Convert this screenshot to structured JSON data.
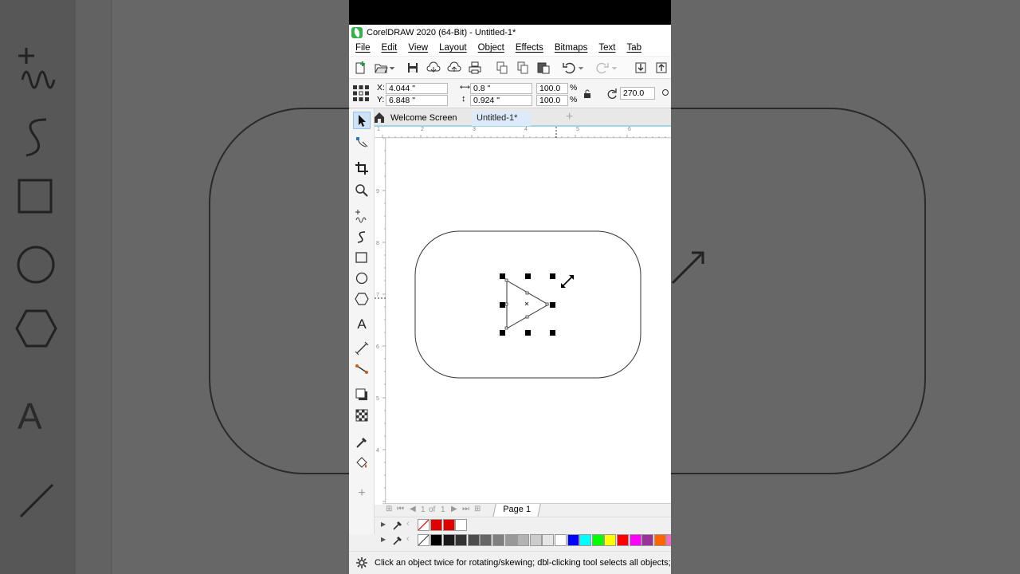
{
  "window": {
    "title": "CorelDRAW 2020 (64-Bit) - Untitled-1*"
  },
  "menu": [
    "File",
    "Edit",
    "View",
    "Layout",
    "Object",
    "Effects",
    "Bitmaps",
    "Text",
    "Tab"
  ],
  "toolbar": {
    "icons": [
      "new-document-icon",
      "open-icon",
      "dropdown-icon",
      "save-icon",
      "cloud-download-icon",
      "cloud-upload-icon",
      "print-icon",
      "cut-icon",
      "copy-icon",
      "paste-icon",
      "undo-icon",
      "redo-icon",
      "import-icon",
      "export-icon"
    ]
  },
  "properties": {
    "x_label": "X:",
    "x_value": "4.044 \"",
    "y_label": "Y:",
    "y_value": "6.848 \"",
    "width_value": "0.8 \"",
    "height_value": "0.924 \"",
    "scale_x": "100.0",
    "scale_y": "100.0",
    "percent": "%",
    "rotation": "270.0"
  },
  "tabs": [
    {
      "label": "Welcome Screen",
      "active": false
    },
    {
      "label": "Untitled-1*",
      "active": true
    }
  ],
  "ruler": {
    "h_ticks": [
      "1",
      "2",
      "3",
      "4",
      "5",
      "6"
    ],
    "v_ticks": [
      "9",
      "8",
      "7",
      "6",
      "5",
      "4"
    ]
  },
  "page_nav": {
    "current": "1",
    "of_label": "of",
    "total": "1",
    "page_tab": "Page 1"
  },
  "palette": {
    "document_colors": [
      "#e00000",
      "#e00000",
      "#ffffff"
    ],
    "default_colors": [
      "#000000",
      "#1a1a1a",
      "#333333",
      "#4d4d4d",
      "#666666",
      "#808080",
      "#999999",
      "#b3b3b3",
      "#cccccc",
      "#e6e6e6",
      "#ffffff",
      "#0000ff",
      "#00ffff",
      "#00ff00",
      "#ffff00",
      "#ff0000",
      "#ff00ff",
      "#993399",
      "#ff6600",
      "#ff66cc"
    ]
  },
  "status": {
    "message": "Click an object twice for rotating/skewing; dbl-clicking tool selects all objects;"
  }
}
